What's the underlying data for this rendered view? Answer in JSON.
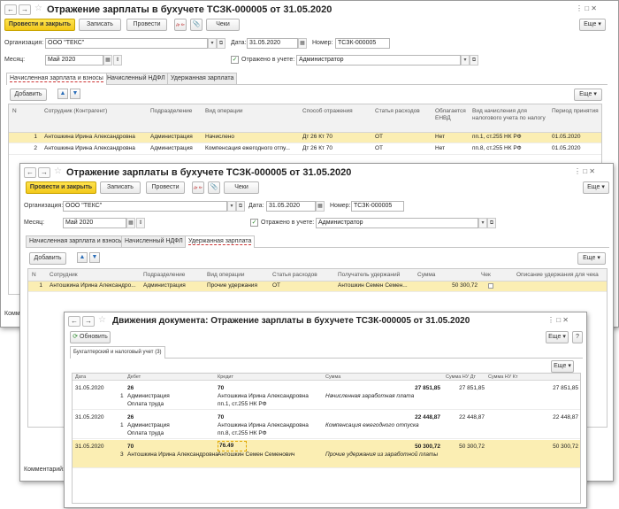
{
  "w1": {
    "title": "Отражение зарплаты в бухучете ТСЗК-000005 от 31.05.2020",
    "nav_back": "←",
    "nav_fwd": "→",
    "star": "☆",
    "ctl": "⋮   □   ✕",
    "toolbar": {
      "post_close": "Провести и закрыть",
      "save": "Записать",
      "post": "Провести",
      "doc_icon": "Дт Кт",
      "clip": "📎",
      "checks": "Чеки",
      "more": "Еще ▾"
    },
    "org_label": "Организация:",
    "org_value": "ООО \"ТЕКС\"",
    "date_label": "Дата:",
    "date_value": "31.05.2020",
    "num_label": "Номер:",
    "num_value": "ТСЗК-000005",
    "month_label": "Месяц:",
    "month_value": "Май 2020",
    "reflected_label": "Отражено в учете:",
    "reflected_value": "Администратор",
    "tabs": [
      "Начисленная зарплата и взносы",
      "Начисленный НДФЛ",
      "Удержанная зарплата"
    ],
    "add": "Добавить",
    "more2": "Еще ▾",
    "headers": [
      "N",
      "Сотрудник (Контрагент)",
      "Подразделение",
      "Вид операции",
      "Способ отражения",
      "Статья расходов",
      "Облагается ЕНВД",
      "Вид начисления для налогового учета по налогу",
      "Период принятия"
    ],
    "rows": [
      [
        "1",
        "Антошкина Ирина Александровна",
        "Администрация",
        "Начислено",
        "Дт 26 Кт 70",
        "ОТ",
        "Нет",
        "пп.1, ст.255 НК РФ",
        "01.05.2020"
      ],
      [
        "2",
        "Антошкина Ирина Александровна",
        "Администрация",
        "Компенсация ежегодного отпу...",
        "Дт 26 Кт 70",
        "ОТ",
        "Нет",
        "пп.8, ст.255 НК РФ",
        "01.05.2020"
      ]
    ],
    "comment": "Комментарий:"
  },
  "w2": {
    "title": "Отражение зарплаты в бухучете ТСЗК-000005 от 31.05.2020",
    "toolbar": {
      "post_close": "Провести и закрыть",
      "save": "Записать",
      "post": "Провести",
      "doc_icon": "Дт Кт",
      "clip": "📎",
      "checks": "Чеки",
      "more": "Еще ▾"
    },
    "org_label": "Организация:",
    "org_value": "ООО \"ТЕКС\"",
    "date_label": "Дата:",
    "date_value": "31.05.2020",
    "num_label": "Номер:",
    "num_value": "ТСЗК-000005",
    "month_label": "Месяц:",
    "month_value": "Май 2020",
    "reflected_label": "Отражено в учете:",
    "reflected_value": "Администратор",
    "tabs": [
      "Начисленная зарплата и взносы",
      "Начисленный НДФЛ",
      "Удержанная зарплата"
    ],
    "add": "Добавить",
    "more2": "Еще ▾",
    "headers": [
      "N",
      "Сотрудник",
      "Подразделение",
      "Вид операции",
      "Статья расходов",
      "Получатель удержаний",
      "Сумма",
      "Чек",
      "Описание удержания для чека"
    ],
    "row": [
      "1",
      "Антошкина Ирина Александро...",
      "Администрация",
      "Прочие удержания",
      "ОТ",
      "Антошкин Семен Семен...",
      "50 300,72",
      "",
      ""
    ],
    "comment": "Комментарий:"
  },
  "w3": {
    "title": "Движения документа: Отражение зарплаты в бухучете ТСЗК-000005 от 31.05.2020",
    "refresh": "Обновить",
    "more": "Еще ▾",
    "help": "?",
    "more2": "Еще ▾",
    "tab": "Бухгалтерский и налоговый учет (3)",
    "headers": [
      "Дата",
      "Дебет",
      "Кредит",
      "Сумма",
      "Сумма НУ Дт",
      "Сумма НУ Кт"
    ],
    "entries": [
      {
        "date": "31.05.2020",
        "dt": "26",
        "kt": "70",
        "sum": "27 851,85",
        "dt_sub1": "1",
        "dt_a1": "Администрация",
        "kt_a1": "Антошкина Ирина Александровна",
        "content": "Начисленная заработная плата",
        "sum2": "27 851,85",
        "sum3": "27 851,85",
        "dt_a2": "Оплата труда",
        "kt_a2": "пп.1, ст.255 НК РФ"
      },
      {
        "date": "31.05.2020",
        "dt": "26",
        "kt": "70",
        "sum": "22 448,87",
        "dt_sub1": "1",
        "dt_a1": "Администрация",
        "kt_a1": "Антошкина Ирина Александровна",
        "content": "Компенсация ежегодного отпуска",
        "sum2": "22 448,87",
        "sum3": "22 448,87",
        "dt_a2": "Оплата труда",
        "kt_a2": "пп.8, ст.255 НК РФ"
      },
      {
        "date": "31.05.2020",
        "dt": "70",
        "kt": "76.49",
        "sum": "50 300,72",
        "dt_sub1": "3",
        "dt_a1": "Антошкина Ирина Александровна",
        "kt_a1": "Антошкин Семен Семенович",
        "content": "Прочие удержания из заработной платы",
        "sum2": "50 300,72",
        "sum3": "50 300,72",
        "dt_a2": "",
        "kt_a2": ""
      }
    ]
  }
}
